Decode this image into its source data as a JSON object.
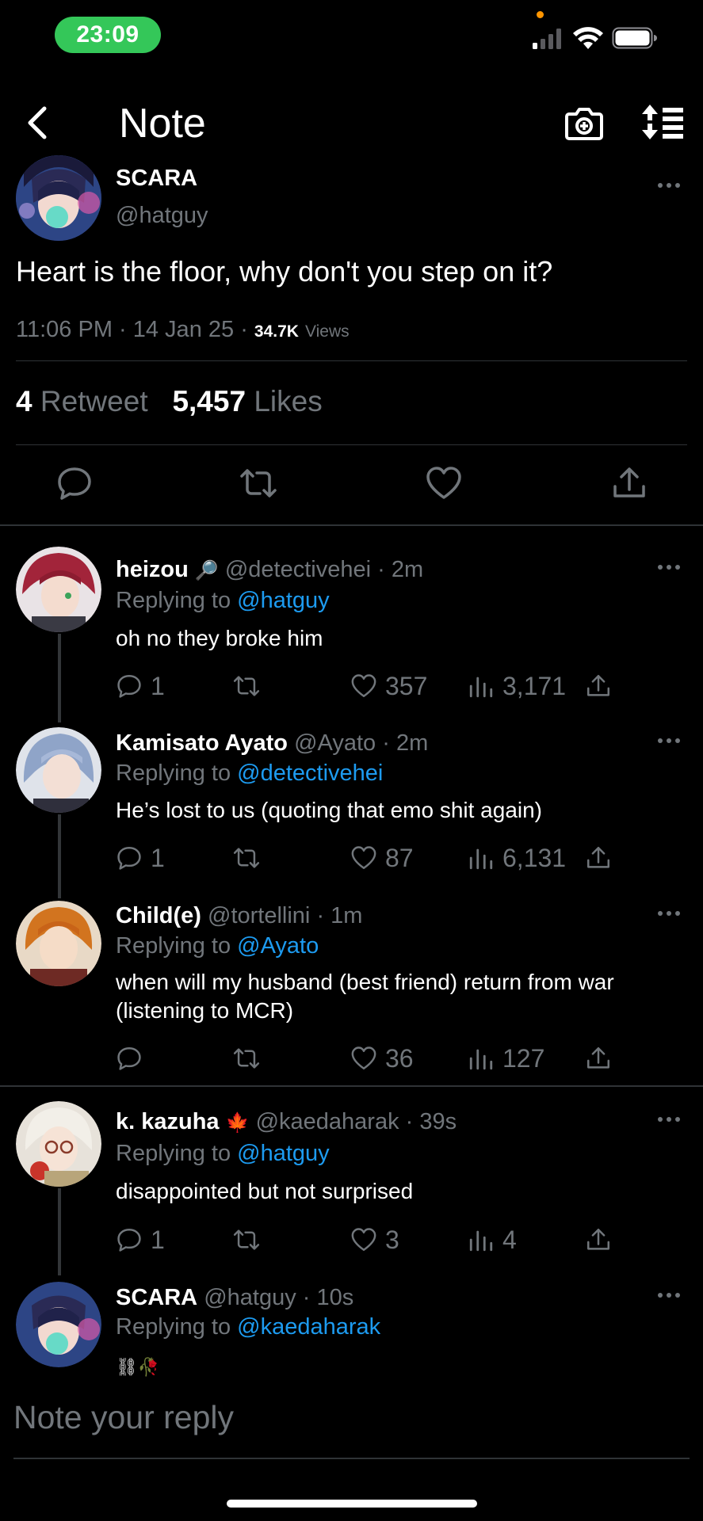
{
  "status_bar": {
    "time": "23:09"
  },
  "header": {
    "title": "Note"
  },
  "main_tweet": {
    "name": "SCARA",
    "handle": "@hatguy",
    "text": "Heart is the floor, why don't you step on it?",
    "meta_time": "11:06 PM · 14 Jan 25 · ",
    "views_count": "34.7K",
    "views_label": "Views",
    "retweets_count": "4",
    "retweets_label": "Retweet",
    "likes_count": "5,457",
    "likes_label": "Likes"
  },
  "replies": [
    {
      "name": "heizou",
      "name_emoji": "🔎",
      "handle": "@detectivehei",
      "age": "· 2m",
      "replying_prefix": "Replying to",
      "replying_to": "@hatguy",
      "text": "oh no they broke him",
      "reply_count": "1",
      "retweet_count": "",
      "like_count": "357",
      "view_count": "3,171"
    },
    {
      "name": "Kamisato Ayato",
      "name_emoji": "",
      "handle": "@Ayato",
      "age": "· 2m",
      "replying_prefix": "Replying to",
      "replying_to": "@detectivehei",
      "text": "He’s lost to us (quoting that emo shit again)",
      "reply_count": "1",
      "retweet_count": "",
      "like_count": "87",
      "view_count": "6,131"
    },
    {
      "name": "Child(e)",
      "name_emoji": "",
      "handle": "@tortellini",
      "age": "· 1m",
      "replying_prefix": "Replying to",
      "replying_to": "@Ayato",
      "text": "when will my husband (best friend) return from war (listening to MCR)",
      "reply_count": "",
      "retweet_count": "",
      "like_count": "36",
      "view_count": "127"
    },
    {
      "name": "k. kazuha",
      "name_emoji": "🍁",
      "handle": "@kaedaharak",
      "age": "· 39s",
      "replying_prefix": "Replying to",
      "replying_to": "@hatguy",
      "text": "disappointed but not surprised",
      "reply_count": "1",
      "retweet_count": "",
      "like_count": "3",
      "view_count": "4"
    },
    {
      "name": "SCARA",
      "name_emoji": "",
      "handle": "@hatguy",
      "age": "· 10s",
      "replying_prefix": "Replying to",
      "replying_to": "@kaedaharak",
      "text": "⛓🥀"
    }
  ],
  "composer": {
    "placeholder": "Note your reply"
  },
  "colors": {
    "accent": "#1d9bf0",
    "muted": "#71767b",
    "time_pill": "#34c759"
  }
}
